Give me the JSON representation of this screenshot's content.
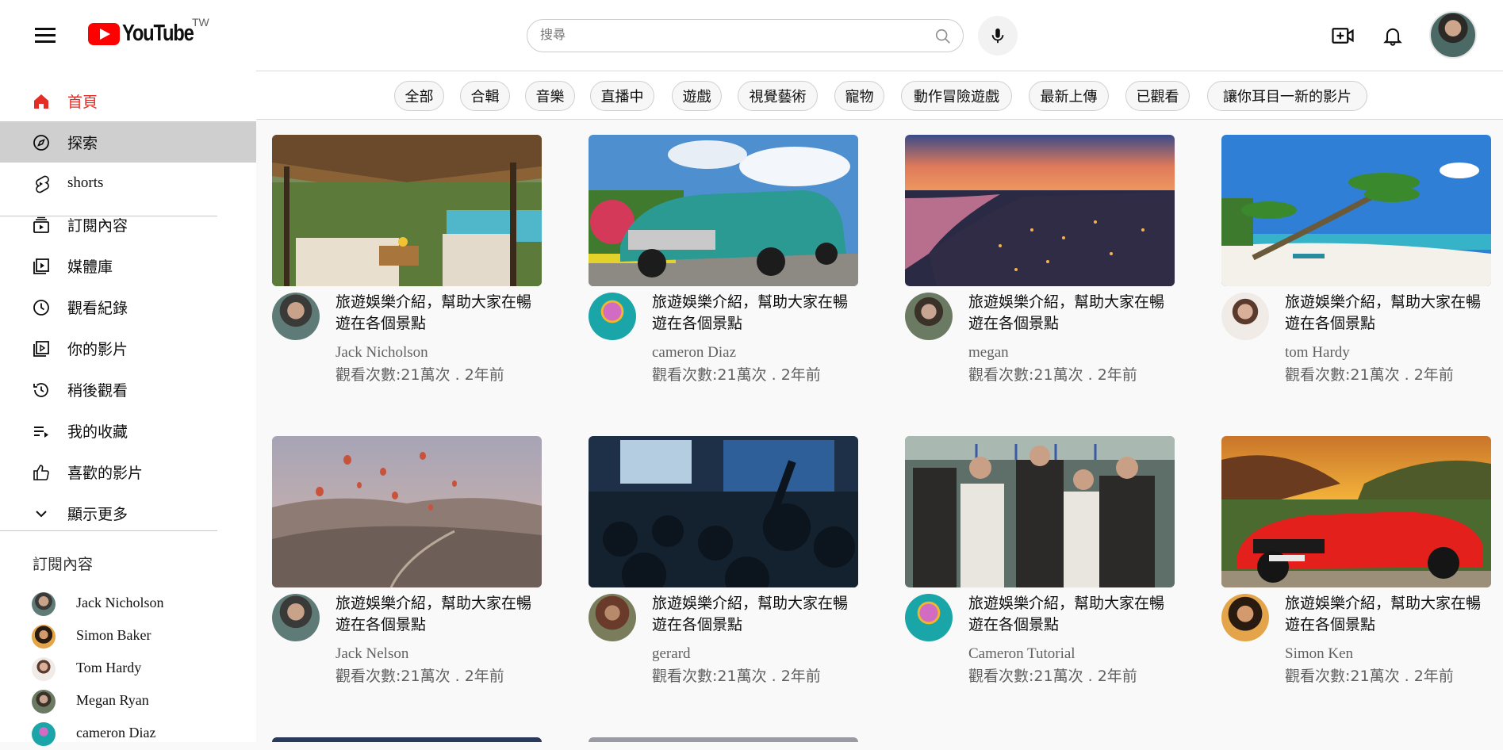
{
  "brand": {
    "name": "YouTube",
    "country": "TW",
    "accent": "#ff0000"
  },
  "search": {
    "placeholder": "搜尋"
  },
  "sidebar": {
    "items": [
      {
        "label": "首頁",
        "icon": "home-icon"
      },
      {
        "label": "探索",
        "icon": "compass-icon"
      },
      {
        "label": "shorts",
        "icon": "shorts-icon"
      },
      {
        "label": "訂閱內容",
        "icon": "subscriptions-icon"
      },
      {
        "label": "媒體庫",
        "icon": "library-icon"
      },
      {
        "label": "觀看紀錄",
        "icon": "history-icon"
      },
      {
        "label": "你的影片",
        "icon": "your-videos-icon"
      },
      {
        "label": "稍後觀看",
        "icon": "watch-later-icon"
      },
      {
        "label": "我的收藏",
        "icon": "playlist-icon"
      },
      {
        "label": "喜歡的影片",
        "icon": "like-icon"
      },
      {
        "label": "顯示更多",
        "icon": "chevron-down-icon"
      }
    ],
    "subscriptions_title": "訂閱內容",
    "subscriptions": [
      {
        "name": "Jack Nicholson"
      },
      {
        "name": "Simon Baker"
      },
      {
        "name": "Tom Hardy"
      },
      {
        "name": "Megan Ryan"
      },
      {
        "name": "cameron Diaz"
      }
    ]
  },
  "chips": [
    "全部",
    "合輯",
    "音樂",
    "直播中",
    "遊戲",
    "視覺藝術",
    "寵物",
    "動作冒險遊戲",
    "最新上傳",
    "已觀看",
    "讓你耳目一新的影片"
  ],
  "videos": [
    {
      "title": "旅遊娛樂介紹，幫助大家在暢遊在各個景點",
      "channel": "Jack Nicholson",
      "meta": "觀看次數:21萬次 . 2年前"
    },
    {
      "title": "旅遊娛樂介紹，幫助大家在暢遊在各個景點",
      "channel": "cameron Diaz",
      "meta": "觀看次數:21萬次 . 2年前"
    },
    {
      "title": "旅遊娛樂介紹，幫助大家在暢遊在各個景點",
      "channel": "megan",
      "meta": "觀看次數:21萬次 . 2年前"
    },
    {
      "title": "旅遊娛樂介紹，幫助大家在暢遊在各個景點",
      "channel": "tom Hardy",
      "meta": "觀看次數:21萬次 . 2年前"
    },
    {
      "title": "旅遊娛樂介紹，幫助大家在暢遊在各個景點",
      "channel": "Jack Nelson",
      "meta": "觀看次數:21萬次 . 2年前"
    },
    {
      "title": "旅遊娛樂介紹，幫助大家在暢遊在各個景點",
      "channel": "gerard",
      "meta": "觀看次數:21萬次 . 2年前"
    },
    {
      "title": "旅遊娛樂介紹，幫助大家在暢遊在各個景點",
      "channel": "Cameron Tutorial",
      "meta": "觀看次數:21萬次 . 2年前"
    },
    {
      "title": "旅遊娛樂介紹，幫助大家在暢遊在各個景點",
      "channel": "Simon Ken",
      "meta": "觀看次數:21萬次 . 2年前"
    }
  ]
}
